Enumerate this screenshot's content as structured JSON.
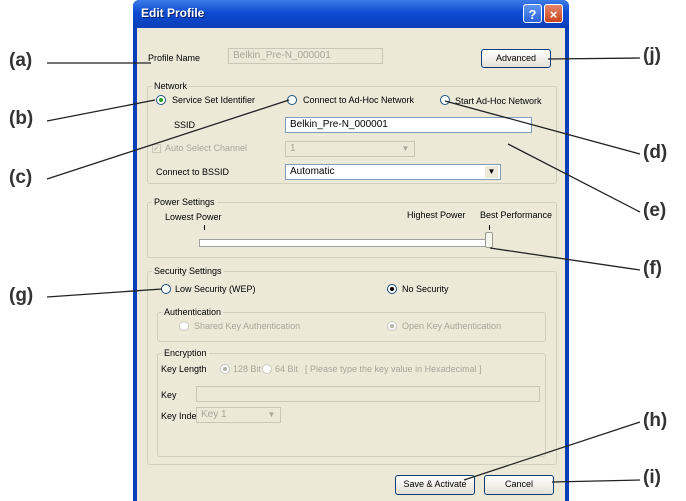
{
  "callouts": {
    "a": "(a)",
    "b": "(b)",
    "c": "(c)",
    "d": "(d)",
    "e": "(e)",
    "f": "(f)",
    "g": "(g)",
    "h": "(h)",
    "i": "(i)",
    "j": "(j)"
  },
  "window": {
    "title": "Edit Profile",
    "help_label": "?",
    "close_label": "×"
  },
  "profile": {
    "label": "Profile Name",
    "value": "Belkin_Pre-N_000001",
    "advanced_label": "Advanced"
  },
  "network": {
    "group_label": "Network",
    "options": [
      "Service Set Identifier",
      "Connect to Ad-Hoc Network",
      "Start Ad-Hoc Network"
    ],
    "selected": "Service Set Identifier",
    "ssid_label": "SSID",
    "ssid_value": "Belkin_Pre-N_000001",
    "auto_channel_label": "Auto Select Channel",
    "channel_value": "1",
    "bssid_label": "Connect to BSSID",
    "bssid_value": "Automatic"
  },
  "power": {
    "group_label": "Power Settings",
    "lowest": "Lowest Power",
    "highest": "Highest Power",
    "best": "Best Performance",
    "slider_level": 1.0
  },
  "security": {
    "group_label": "Security Settings",
    "low_label": "Low Security (WEP)",
    "none_label": "No Security",
    "selected": "No Security",
    "auth_group": "Authentication",
    "shared_label": "Shared Key Authentication",
    "open_label": "Open Key Authentication",
    "enc_group": "Encryption",
    "key_length_label": "Key Length",
    "bits128": "128 Bit",
    "bits64": "64 Bit",
    "hex_hint": "[ Please type the key value in Hexadecimal ]",
    "key_label": "Key",
    "key_index_label": "Key Index",
    "key_index_value": "Key 1"
  },
  "buttons": {
    "save": "Save & Activate",
    "cancel": "Cancel"
  }
}
